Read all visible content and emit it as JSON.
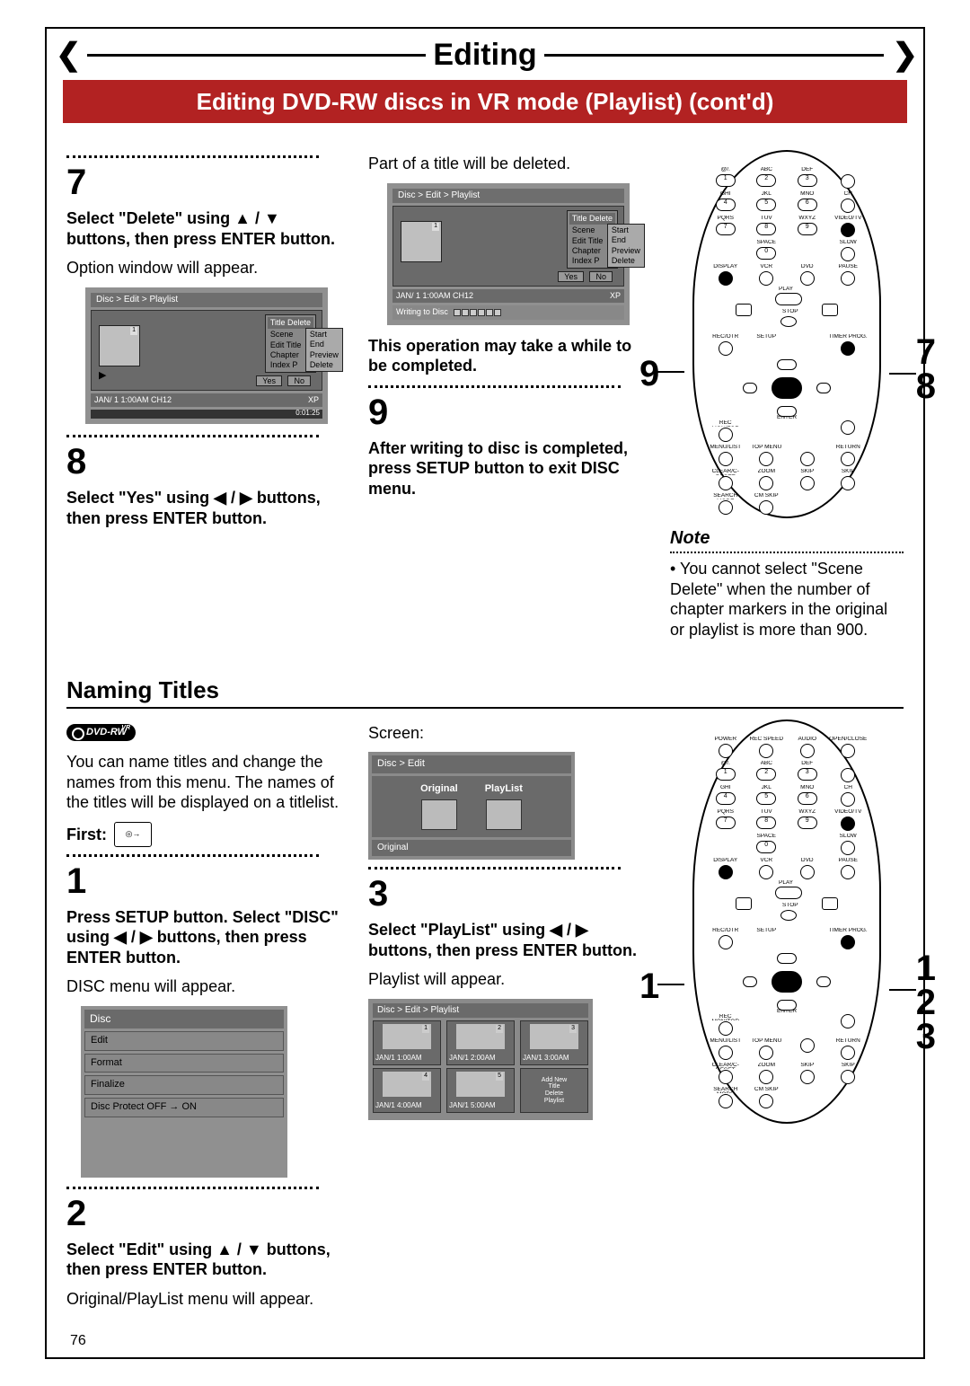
{
  "header": {
    "title": "Editing",
    "subtitle": "Editing DVD-RW discs in VR mode (Playlist) (cont'd)"
  },
  "col1": {
    "step7": {
      "num": "7",
      "bold": "Select \"Delete\" using ▲ / ▼ buttons, then press ENTER button.",
      "text": "Option window will appear."
    },
    "screen7": {
      "crumb": "Disc > Edit > Playlist",
      "menu_header": "Title Delete",
      "menu_rows": [
        "Scene",
        "Edit Title",
        "Chapter",
        "Index P"
      ],
      "submenu": [
        "Start",
        "End",
        "Preview",
        "Delete"
      ],
      "yes": "Yes",
      "no": "No",
      "status_l": "JAN/ 1   1:00AM  CH12",
      "status_r": "XP",
      "time": "0:01:25"
    },
    "step8": {
      "num": "8",
      "bold": "Select \"Yes\" using ◀ / ▶ buttons, then press ENTER button."
    },
    "section2": "Naming Titles",
    "dvdrw": "DVD-RW",
    "intro": "You can name titles and change the names from this menu. The names of the titles will be displayed on a titlelist.",
    "first": "First:",
    "step1": {
      "num": "1",
      "bold": "Press SETUP button. Select \"DISC\" using ◀ / ▶ buttons, then press ENTER button.",
      "text": "DISC menu will appear."
    },
    "disc_menu": {
      "header": "Disc",
      "items": [
        "Edit",
        "Format",
        "Finalize",
        "Disc Protect OFF → ON"
      ]
    },
    "step2": {
      "num": "2",
      "bold": "Select \"Edit\" using ▲ / ▼ buttons, then press ENTER button.",
      "text": "Original/PlayList menu will appear."
    }
  },
  "col2": {
    "intro9": "Part of a title will be deleted.",
    "screen9": {
      "crumb": "Disc > Edit > Playlist",
      "menu_header": "Title Delete",
      "menu_rows": [
        "Scene",
        "Edit Title",
        "Chapter",
        "Index P"
      ],
      "submenu": [
        "Start",
        "End",
        "Preview",
        "Delete"
      ],
      "yes": "Yes",
      "no": "No",
      "status_l": "JAN/ 1   1:00AM  CH12",
      "status_r": "XP",
      "writing": "Writing to Disc"
    },
    "warn": "This operation may take a while to be completed.",
    "step9": {
      "num": "9",
      "bold": "After writing to disc is completed, press SETUP button to exit DISC menu."
    },
    "screen_label": "Screen:",
    "orig_play": {
      "crumb": "Disc > Edit",
      "opt1": "Original",
      "opt2": "PlayList",
      "footer": "Original"
    },
    "step3": {
      "num": "3",
      "bold": "Select \"PlayList\" using ◀ / ▶ buttons, then press ENTER button.",
      "text": "Playlist will appear."
    },
    "pl_grid": {
      "crumb": "Disc > Edit > Playlist",
      "cells": [
        "JAN/1  1:00AM",
        "JAN/1  2:00AM",
        "JAN/1  3:00AM",
        "JAN/1  4:00AM",
        "JAN/1  5:00AM"
      ],
      "menu": [
        "Add New",
        "Title",
        "Delete",
        "Playlist"
      ]
    }
  },
  "col3": {
    "marker_a": "9",
    "marker_b": "7\n8",
    "note_head": "Note",
    "note_text": "You cannot select \"Scene Delete\" when the number of chapter markers in the original or playlist is more than 900.",
    "marker_c": "1",
    "marker_d": "1\n2\n3",
    "remote_labels": {
      "row1": [
        "@/.",
        "ABC",
        "DEF",
        ""
      ],
      "row2": [
        "GHI",
        "JKL",
        "MNO",
        "CH"
      ],
      "row3": [
        "PQRS",
        "TUV",
        "WXYZ",
        "VIDEO/TV"
      ],
      "row4": [
        "",
        "SPACE",
        "",
        "SLOW"
      ],
      "row5": [
        "DISPLAY",
        "VCR",
        "DVD",
        "PAUSE"
      ],
      "play": "PLAY",
      "stop": "STOP",
      "row6": [
        "REC/OTR",
        "SETUP",
        "",
        "TIMER PROG."
      ],
      "row7": [
        "REC MONITOR",
        "",
        "ENTER",
        ""
      ],
      "row8": [
        "MENU/LIST",
        "TOP MENU",
        "",
        "RETURN"
      ],
      "row9": [
        "CLEAR/C-RESET",
        "ZOOM",
        "SKIP",
        "SKIP"
      ],
      "row10": [
        "SEARCH MODE",
        "CM SKIP",
        "",
        ""
      ],
      "top": [
        "POWER",
        "REC SPEED",
        "AUDIO",
        "OPEN/CLOSE"
      ]
    }
  },
  "page_number": "76"
}
